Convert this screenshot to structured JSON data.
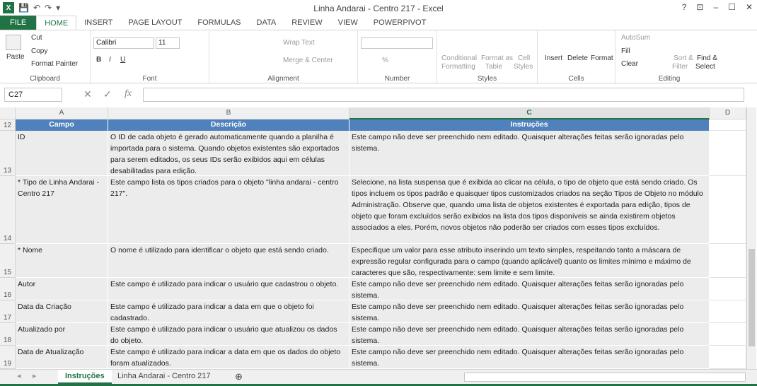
{
  "window": {
    "title": "Linha Andarai - Centro 217 - Excel",
    "controls": [
      "?",
      "⊡",
      "–",
      "☐",
      "✕"
    ]
  },
  "quick_access": [
    "💾",
    "↶",
    "↷",
    "▾"
  ],
  "ribbon_tabs": [
    "FILE",
    "HOME",
    "INSERT",
    "PAGE LAYOUT",
    "FORMULAS",
    "DATA",
    "REVIEW",
    "VIEW",
    "POWERPIVOT"
  ],
  "ribbon": {
    "clipboard": {
      "paste": "Paste",
      "cut": "Cut",
      "copy": "Copy",
      "format_painter": "Format Painter",
      "label": "Clipboard"
    },
    "font": {
      "name": "Calibri",
      "size": "11",
      "bold": "B",
      "italic": "I",
      "underline": "U",
      "label": "Font"
    },
    "alignment": {
      "wrap_text": "Wrap Text",
      "merge_center": "Merge & Center",
      "label": "Alignment"
    },
    "number": {
      "format": "",
      "percent": "%",
      "label": "Number"
    },
    "styles": {
      "conditional": "Conditional",
      "conditional2": "Formatting",
      "format_as": "Format as",
      "format_as2": "Table",
      "cell": "Cell",
      "cell2": "Styles",
      "label": "Styles"
    },
    "cells": {
      "insert": "Insert",
      "delete": "Delete",
      "format": "Format",
      "label": "Cells"
    },
    "editing": {
      "autosum": "AutoSum",
      "fill": "Fill",
      "clear": "Clear",
      "sort": "Sort &",
      "sort2": "Filter",
      "find": "Find &",
      "find2": "Select",
      "label": "Editing"
    }
  },
  "formula_bar": {
    "name_box": "C27",
    "fx": "fx",
    "value": ""
  },
  "columns": [
    "A",
    "B",
    "C",
    "D"
  ],
  "header_row": {
    "row": "12",
    "a": "Campo",
    "b": "Descrição",
    "c": "Instruções"
  },
  "rows": [
    {
      "row": "13",
      "a": "ID",
      "b": "O ID de cada objeto é gerado automaticamente quando a planilha é importada para o sistema. Quando objetos existentes são exportados para serem editados, os seus IDs serão exibidos aqui em células desabilitadas para edição.",
      "c": "Este campo não deve ser preenchido nem editado. Quaisquer alterações feitas serão ignoradas pelo sistema."
    },
    {
      "row": "14",
      "a": "* Tipo de Linha Andarai - Centro 217",
      "b": "Este campo lista os tipos criados para o objeto \"linha andarai - centro 217\".",
      "c": "Selecione, na lista suspensa que é exibida ao clicar na célula, o tipo de objeto que está sendo criado. Os tipos incluem os tipos padrão e quaisquer tipos customizados criados na seção Tipos de Objeto no módulo Administração. Observe que, quando uma lista de objetos existentes é exportada para edição, tipos de objeto que foram excluídos serão exibidos na lista dos tipos disponíveis se ainda existirem objetos associados a eles. Porém, novos objetos não poderão ser criados com esses tipos excluídos."
    },
    {
      "row": "15",
      "a": "* Nome",
      "b": "O nome é utilizado para identificar o objeto que está sendo criado.",
      "c": "Especifique um valor para esse atributo inserindo um texto simples, respeitando tanto a máscara de expressão regular configurada para o campo (quando aplicável) quanto os limites mínimo e máximo de caracteres que são, respectivamente: sem limite e sem limite."
    },
    {
      "row": "16",
      "a": "Autor",
      "b": "Este campo é utilizado para indicar o usuário que cadastrou o objeto.",
      "c": "Este campo não deve ser preenchido nem editado. Quaisquer alterações feitas serão ignoradas pelo sistema."
    },
    {
      "row": "17",
      "a": "Data da Criação",
      "b": "Este campo é utilizado para indicar a data em que o objeto foi cadastrado.",
      "c": "Este campo não deve ser preenchido nem editado. Quaisquer alterações feitas serão ignoradas pelo sistema."
    },
    {
      "row": "18",
      "a": "Atualizado por",
      "b": "Este campo é utilizado para indicar o usuário que atualizou os dados do objeto.",
      "c": "Este campo não deve ser preenchido nem editado. Quaisquer alterações feitas serão ignoradas pelo sistema."
    },
    {
      "row": "19",
      "a": "Data de Atualização",
      "b": "Este campo é utilizado para indicar a data em que os dados do objeto foram atualizados.",
      "c": "Este campo não deve ser preenchido nem editado. Quaisquer alterações feitas serão ignoradas pelo sistema."
    }
  ],
  "sheets": [
    "Instruções",
    "Linha Andarai - Centro 217"
  ],
  "add_sheet": "⊕",
  "colors": {
    "accent": "#217346",
    "header_fill": "#4f81bd",
    "cell_fill": "#ececec"
  }
}
